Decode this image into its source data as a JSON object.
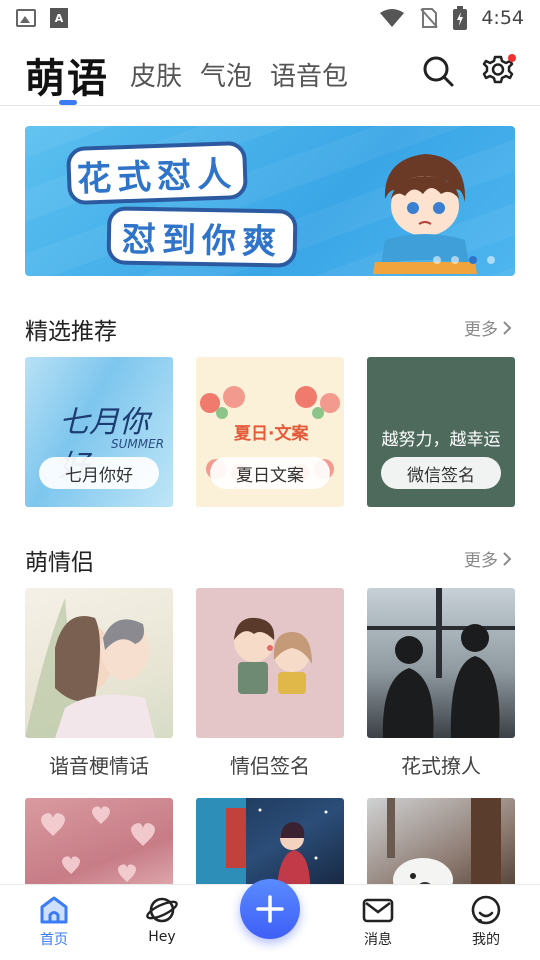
{
  "status_bar": {
    "time": "4:54",
    "icons": [
      "image-icon",
      "a-icon",
      "wifi-icon",
      "no-sim-icon",
      "battery-charging-icon"
    ]
  },
  "top_tabs": {
    "active": "萌语",
    "tabs": [
      "皮肤",
      "气泡",
      "语音包"
    ],
    "accent": "#3b7cf6",
    "icons": [
      "search-icon",
      "settings-icon"
    ]
  },
  "banner": {
    "line1": "花式怼人",
    "line2": "怼到你爽",
    "page_count": 4,
    "active_page": 3
  },
  "section_featured": {
    "title": "精选推荐",
    "more": "更多",
    "cards": [
      {
        "label": "七月你好",
        "image_text": "七月你好",
        "image_subtext": "SUMMER"
      },
      {
        "label": "夏日文案",
        "image_text": "夏日·文案"
      },
      {
        "label": "微信签名",
        "image_text": "越努力，越幸运"
      }
    ]
  },
  "section_couple": {
    "title": "萌情侣",
    "more": "更多",
    "cards": [
      {
        "label": "谐音梗情话"
      },
      {
        "label": "情侣签名"
      },
      {
        "label": "花式撩人"
      }
    ]
  },
  "bottom_nav": {
    "items": [
      {
        "label": "首页",
        "icon": "home-icon",
        "active": true
      },
      {
        "label": "Hey",
        "icon": "planet-icon"
      },
      {
        "label": "消息",
        "icon": "mail-icon"
      },
      {
        "label": "我的",
        "icon": "smiley-icon"
      }
    ],
    "fab_icon": "plus-icon"
  }
}
